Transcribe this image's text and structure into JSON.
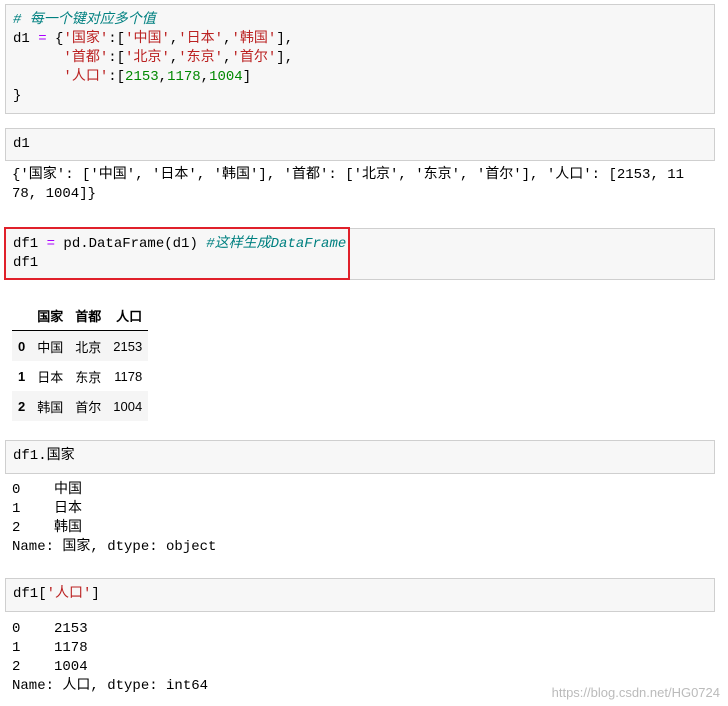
{
  "cells": [
    {
      "lines": [
        "# 每一个键对应多个值",
        "d1 = {'国家':['中国','日本','韩国'],",
        "'首都':['北京','东京','首尔'],",
        "'人口':[2153,1178,1004]",
        "}"
      ]
    },
    {
      "code": "d1",
      "output": [
        "{'国家': ['中国', '日本', '韩国'], '首都': ['北京', '东京', '首尔'], '人口': [2153, 11",
        "78, 1004]}"
      ]
    },
    {
      "code1": "df1 = pd.DataFrame(d1) ",
      "comment": "#这样生成DataFrame",
      "code2": "df1"
    },
    {
      "code": "df1.国家",
      "output": [
        "0    中国",
        "1    日本",
        "2    韩国",
        "Name: 国家, dtype: object"
      ]
    },
    {
      "code_pre": "df1[",
      "code_str": "'人口'",
      "code_post": "]",
      "output": [
        "0    2153",
        "1    1178",
        "2    1004",
        "Name: 人口, dtype: int64"
      ]
    }
  ],
  "table": {
    "columns": [
      "",
      "国家",
      "首都",
      "人口"
    ],
    "rows": [
      [
        "0",
        "中国",
        "北京",
        "2153"
      ],
      [
        "1",
        "日本",
        "东京",
        "1178"
      ],
      [
        "2",
        "韩国",
        "首尔",
        "1004"
      ]
    ]
  },
  "watermark": "https://blog.csdn.net/HG0724"
}
